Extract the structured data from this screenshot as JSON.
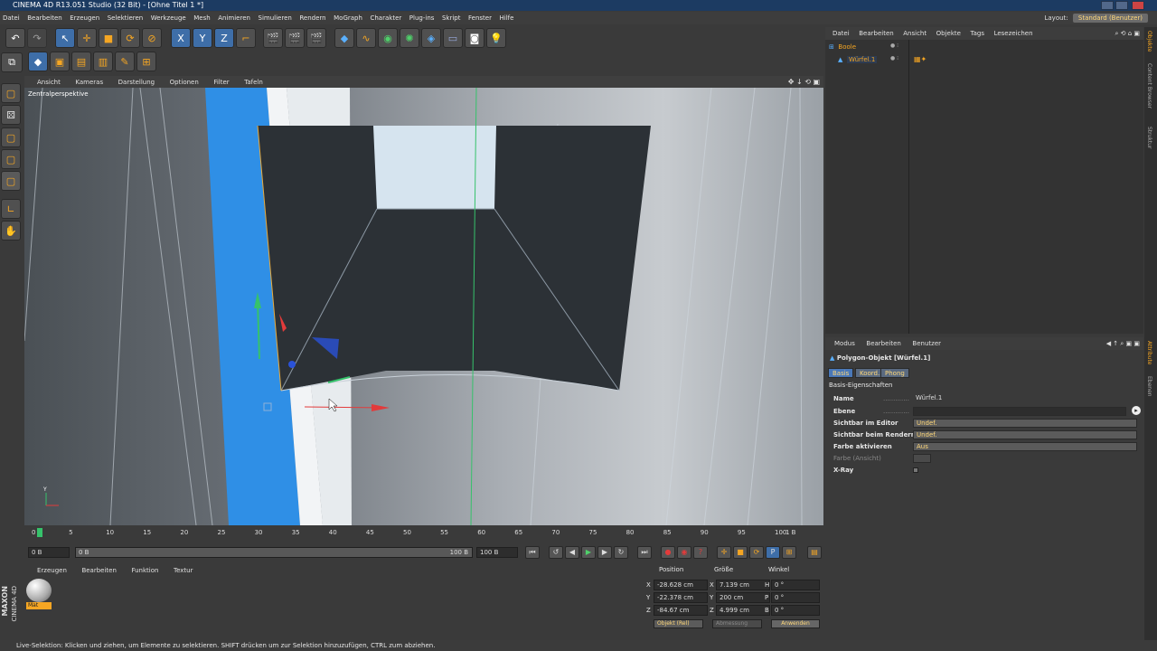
{
  "window": {
    "title": "CINEMA 4D R13.051 Studio (32 Bit) - [Ohne Titel 1 *]"
  },
  "menu": [
    "Datei",
    "Bearbeiten",
    "Erzeugen",
    "Selektieren",
    "Werkzeuge",
    "Mesh",
    "Animieren",
    "Simulieren",
    "Rendern",
    "MoGraph",
    "Charakter",
    "Plug-ins",
    "Skript",
    "Fenster",
    "Hilfe"
  ],
  "layout": {
    "label": "Layout:",
    "value": "Standard (Benutzer)"
  },
  "viewport": {
    "menu": [
      "Ansicht",
      "Kameras",
      "Darstellung",
      "Optionen",
      "Filter",
      "Tafeln"
    ],
    "label": "Zentralperspektive"
  },
  "timeline": {
    "ticks": [
      "0",
      "5",
      "10",
      "15",
      "20",
      "25",
      "30",
      "35",
      "40",
      "45",
      "50",
      "55",
      "60",
      "65",
      "70",
      "75",
      "80",
      "85",
      "90",
      "95",
      "100"
    ],
    "frame_end_label": "1 B",
    "start_field": "0 B",
    "range_start": "0 B",
    "range_end": "100 B",
    "end_field": "100 B"
  },
  "material_panel": {
    "menu": [
      "Erzeugen",
      "Bearbeiten",
      "Funktion",
      "Textur"
    ],
    "material_name": "Mat"
  },
  "coords": {
    "headers": [
      "Position",
      "Größe",
      "Winkel"
    ],
    "rows": [
      {
        "axis": "X",
        "pos": "-28.628 cm",
        "size_axis": "X",
        "size": "7.139 cm",
        "rot_axis": "H",
        "rot": "0 °"
      },
      {
        "axis": "Y",
        "pos": "-22.378 cm",
        "size_axis": "Y",
        "size": "200 cm",
        "rot_axis": "P",
        "rot": "0 °"
      },
      {
        "axis": "Z",
        "pos": "-84.67 cm",
        "size_axis": "Z",
        "size": "4.999 cm",
        "rot_axis": "B",
        "rot": "0 °"
      }
    ],
    "mode_select": "Objekt (Rel)",
    "size_select": "Abmessung",
    "apply_label": "Anwenden"
  },
  "status": "Live-Selektion: Klicken und ziehen, um Elemente zu selektieren. SHIFT drücken um zur Selektion hinzuzufügen, CTRL zum abziehen.",
  "object_manager": {
    "menu": [
      "Datei",
      "Bearbeiten",
      "Ansicht",
      "Objekte",
      "Tags",
      "Lesezeichen"
    ],
    "objects": [
      {
        "name": "Boole",
        "level": 0
      },
      {
        "name": "Würfel.1",
        "level": 1
      }
    ]
  },
  "attributes": {
    "menu": [
      "Modus",
      "Bearbeiten",
      "Benutzer"
    ],
    "title": "Polygon-Objekt [Würfel.1]",
    "tabs": [
      "Basis",
      "Koord.",
      "Phong"
    ],
    "section": "Basis-Eigenschaften",
    "rows": [
      {
        "key": "Name",
        "value": "Würfel.1"
      },
      {
        "key": "Ebene",
        "value": ""
      },
      {
        "key": "Sichtbar im Editor",
        "value": "Undef."
      },
      {
        "key": "Sichtbar beim Rendern",
        "value": "Undef."
      },
      {
        "key": "Farbe aktivieren",
        "value": "Aus"
      },
      {
        "key": "Farbe (Ansicht)",
        "value": ""
      },
      {
        "key": "X-Ray",
        "value": ""
      }
    ]
  },
  "sidebar_tabs": [
    "Objekte",
    "Content Browser",
    "Struktur"
  ],
  "sidebar_tabs_lower": [
    "Attribute",
    "Ebenen"
  ],
  "logo": {
    "line1": "MAXON",
    "line2": "CINEMA 4D"
  },
  "colors": {
    "accent": "#ffd87a",
    "titlebar": "#1c3b62",
    "axis_x": "#e23b3b",
    "axis_y": "#36c26b",
    "axis_z": "#2a52d8"
  }
}
